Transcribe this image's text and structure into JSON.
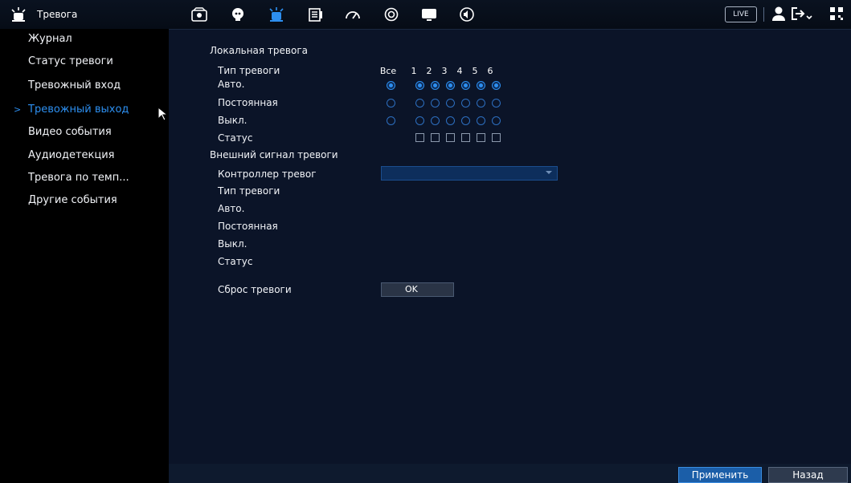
{
  "header": {
    "title": "Тревога",
    "icons": [
      "camera-icon",
      "face-icon",
      "alarm-icon",
      "storage-icon",
      "speedometer-icon",
      "record-icon",
      "display-icon",
      "audio-icon"
    ],
    "live_label": "LIVE"
  },
  "sidebar": {
    "items": [
      {
        "label": "Журнал"
      },
      {
        "label": "Статус тревоги"
      },
      {
        "label": "Тревожный вход"
      },
      {
        "label": "Тревожный выход",
        "active": true
      },
      {
        "label": "Видео события"
      },
      {
        "label": "Аудиодетекция"
      },
      {
        "label": "Тревога по темп..."
      },
      {
        "label": "Другие события"
      }
    ]
  },
  "local": {
    "section_title": "Локальная тревога",
    "type_label": "Тип тревоги",
    "columns": [
      "Все",
      "1",
      "2",
      "3",
      "4",
      "5",
      "6"
    ],
    "auto_label": "Авто.",
    "constant_label": "Постоянная",
    "off_label": "Выкл.",
    "status_label": "Статус",
    "selected_mode": "auto"
  },
  "external": {
    "section_title": "Внешний сигнал тревоги",
    "controller_label": "Контроллер тревог",
    "controller_value": "",
    "type_label": "Тип тревоги",
    "auto_label": "Авто.",
    "constant_label": "Постоянная",
    "off_label": "Выкл.",
    "status_label": "Статус"
  },
  "reset": {
    "label": "Сброс тревоги",
    "button": "OK"
  },
  "footer": {
    "apply": "Применить",
    "back": "Назад"
  },
  "colors": {
    "accent": "#2d8ff0",
    "background": "#0b1428",
    "sidebar": "#000000"
  }
}
